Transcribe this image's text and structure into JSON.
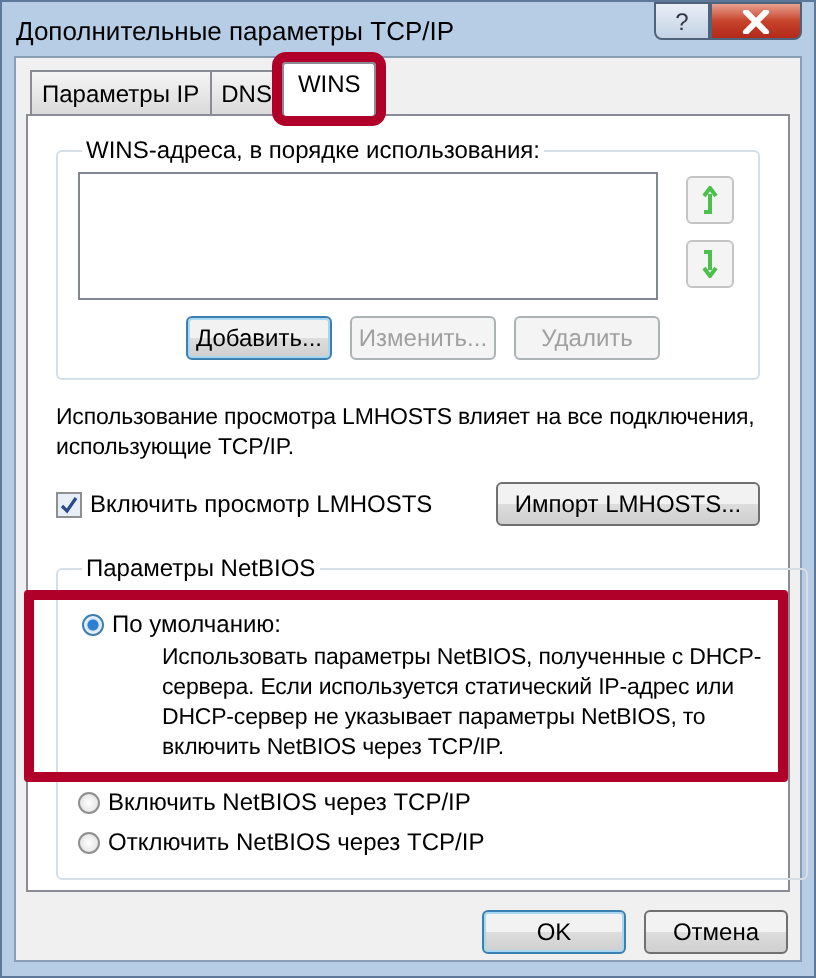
{
  "window": {
    "title": "Дополнительные параметры TCP/IP",
    "help_button": "?"
  },
  "tabs": [
    {
      "label": "Параметры IP",
      "selected": false,
      "highlighted": false
    },
    {
      "label": "DNS",
      "selected": false,
      "highlighted": false
    },
    {
      "label": "WINS",
      "selected": true,
      "highlighted": true
    }
  ],
  "wins_group": {
    "title": "WINS-адреса, в порядке использования:",
    "buttons": [
      {
        "label": "Добавить...",
        "disabled": false
      },
      {
        "label": "Изменить...",
        "disabled": true
      },
      {
        "label": "Удалить",
        "disabled": true
      }
    ]
  },
  "lmhosts": {
    "note": "Использование просмотра LMHOSTS влияет на все подключения, использующие TCP/IP.",
    "checkbox": {
      "label": "Включить просмотр LMHOSTS",
      "checked": true
    },
    "import_button": "Импорт LMHOSTS..."
  },
  "netbios_group": {
    "title": "Параметры NetBIOS",
    "options": [
      {
        "label": "По умолчанию:",
        "selected": true,
        "highlighted": true,
        "description": "Использовать параметры NetBIOS, полученные с DHCP-сервера. Если используется статический IP-адрес или DHCP-сервер не указывает параметры NetBIOS, то включить NetBIOS через TCP/IP."
      },
      {
        "label": "Включить NetBIOS через TCP/IP",
        "selected": false,
        "highlighted": false
      },
      {
        "label": "Отключить NetBIOS через TCP/IP",
        "selected": false,
        "highlighted": false
      }
    ]
  },
  "buttons": [
    {
      "label": "OK",
      "default": true
    },
    {
      "label": "Отмена",
      "default": false
    }
  ]
}
